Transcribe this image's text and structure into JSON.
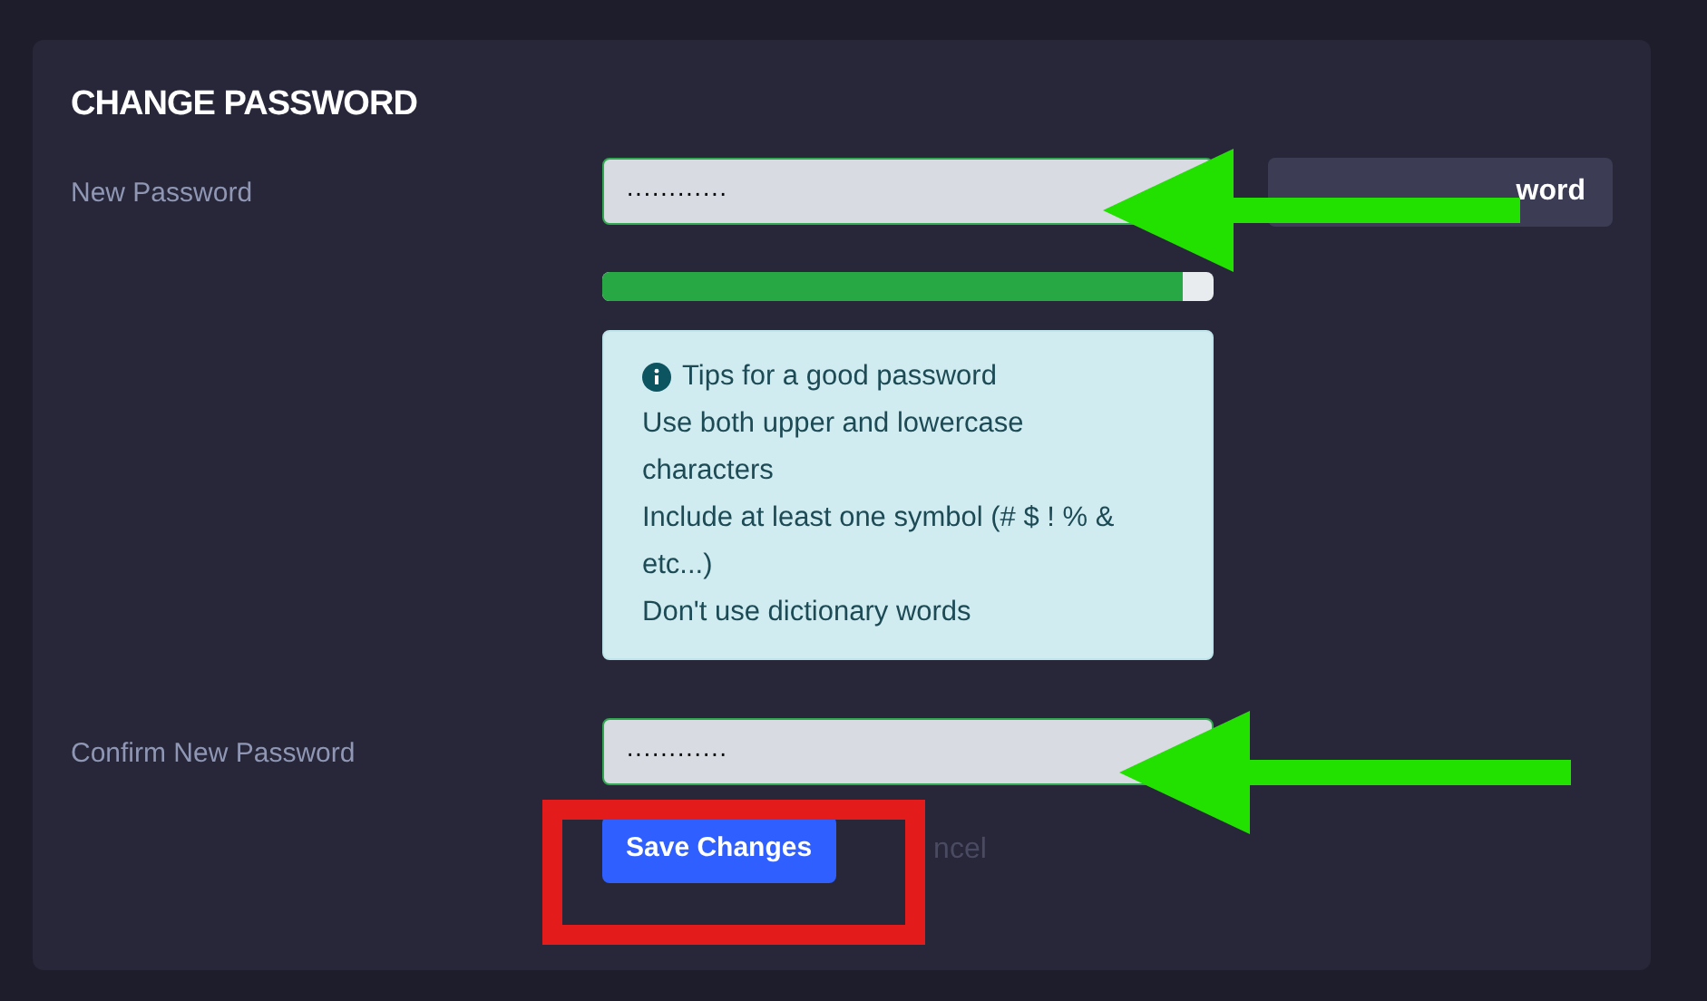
{
  "card": {
    "title": "CHANGE PASSWORD"
  },
  "new_password": {
    "label": "New Password",
    "value": "············",
    "generate_button": "word"
  },
  "strength": {
    "level": 0.95
  },
  "tips": {
    "heading": "Tips for a good password",
    "lines": [
      "Use both upper and lowercase characters",
      "Include at least one symbol (# $ ! % & etc...)",
      "Don't use dictionary words"
    ]
  },
  "confirm_password": {
    "label": "Confirm New Password",
    "value": "············"
  },
  "actions": {
    "save": "Save Changes",
    "cancel": "ncel"
  }
}
